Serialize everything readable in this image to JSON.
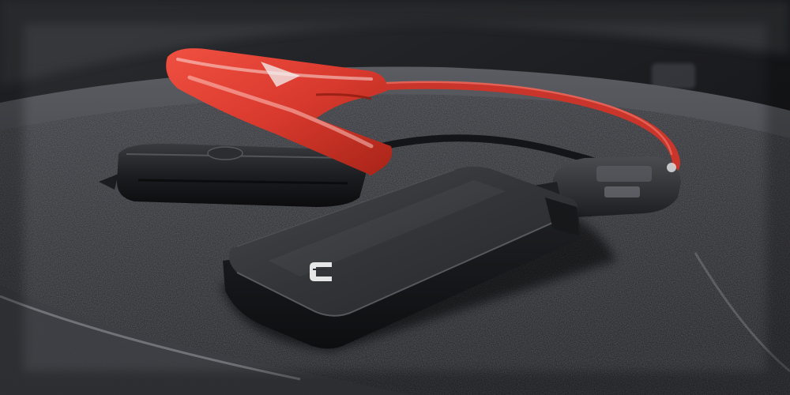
{
  "photo": {
    "subject": "portable-jump-starter",
    "colors": {
      "tray": "#2a2b2f",
      "tray_rim": "#44464b",
      "device_body": "#303134",
      "red_cable": "#d93a2e",
      "black_clamp": "#18191c",
      "highlight": "#e6e6e6"
    },
    "icons": [
      "brand-logo-icon"
    ]
  }
}
